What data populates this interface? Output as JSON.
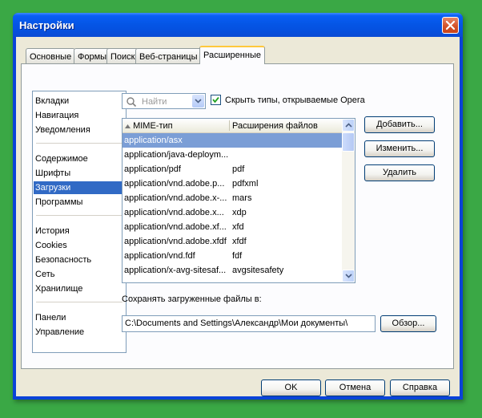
{
  "window": {
    "title": "Настройки"
  },
  "tabs": [
    {
      "label": "Основные"
    },
    {
      "label": "Формы"
    },
    {
      "label": "Поиск"
    },
    {
      "label": "Веб-страницы"
    },
    {
      "label": "Расширенные",
      "active": true
    }
  ],
  "sidebar": {
    "groups": [
      [
        "Вкладки",
        "Навигация",
        "Уведомления"
      ],
      [
        "Содержимое",
        "Шрифты",
        "Загрузки",
        "Программы"
      ],
      [
        "История",
        "Cookies",
        "Безопасность",
        "Сеть",
        "Хранилище"
      ],
      [
        "Панели",
        "Управление"
      ]
    ],
    "selected": "Загрузки"
  },
  "search": {
    "placeholder": "Найти"
  },
  "hide_types": {
    "label": "Скрыть типы, открываемые Opera",
    "checked": true
  },
  "mime_table": {
    "col_mime": "MIME-тип",
    "col_ext": "Расширения файлов",
    "rows": [
      {
        "mime": "application/asx",
        "ext": "",
        "selected": true
      },
      {
        "mime": "application/java-deploym...",
        "ext": ""
      },
      {
        "mime": "application/pdf",
        "ext": "pdf"
      },
      {
        "mime": "application/vnd.adobe.p...",
        "ext": "pdfxml"
      },
      {
        "mime": "application/vnd.adobe.x-...",
        "ext": "mars"
      },
      {
        "mime": "application/vnd.adobe.x...",
        "ext": "xdp"
      },
      {
        "mime": "application/vnd.adobe.xf...",
        "ext": "xfd"
      },
      {
        "mime": "application/vnd.adobe.xfdf",
        "ext": "xfdf"
      },
      {
        "mime": "application/vnd.fdf",
        "ext": "fdf"
      },
      {
        "mime": "application/x-avg-sitesaf...",
        "ext": "avgsitesafety"
      }
    ]
  },
  "side_buttons": {
    "add": "Добавить...",
    "edit": "Изменить...",
    "delete": "Удалить"
  },
  "downloads": {
    "save_label": "Сохранять загруженные файлы в:",
    "path": "C:\\Documents and Settings\\Александр\\Мои документы\\",
    "browse": "Обзор..."
  },
  "footer": {
    "ok": "OK",
    "cancel": "Отмена",
    "help": "Справка"
  },
  "colors": {
    "titlebar": "#0556e6",
    "selection": "#316ac5",
    "dialog_bg": "#ece9d8",
    "desktop": "#3aa845"
  }
}
